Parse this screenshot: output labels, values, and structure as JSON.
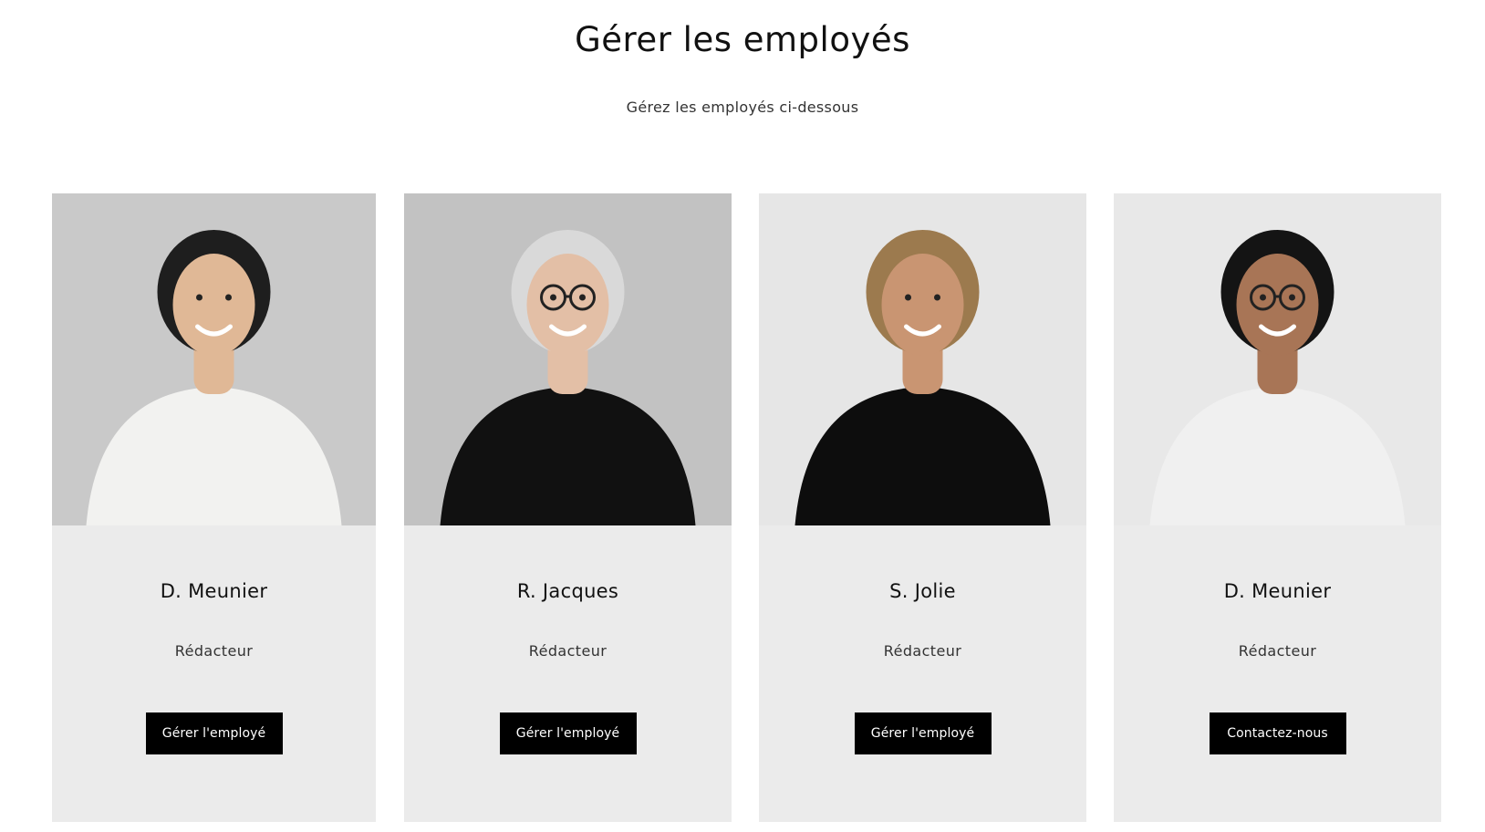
{
  "header": {
    "title": "Gérer les employés",
    "subtitle": "Gérez les employés ci-dessous"
  },
  "employees": [
    {
      "name": "D. Meunier",
      "role": "Rédacteur",
      "button_label": "Gérer l'employé",
      "photo": {
        "background": "#c9c9c9",
        "shirt": "#f2f2f0",
        "hair": "#1e1e1e",
        "skin": "#e0b896",
        "glasses": false
      }
    },
    {
      "name": "R. Jacques",
      "role": "Rédacteur",
      "button_label": "Gérer l'employé",
      "photo": {
        "background": "#c2c2c2",
        "shirt": "#111111",
        "hair": "#d9d9d9",
        "skin": "#e3bfa6",
        "glasses": true
      }
    },
    {
      "name": "S. Jolie",
      "role": "Rédacteur",
      "button_label": "Gérer l'employé",
      "photo": {
        "background": "#e6e6e6",
        "shirt": "#0d0d0d",
        "hair": "#9c7a4e",
        "skin": "#c99572",
        "glasses": false
      }
    },
    {
      "name": "D. Meunier",
      "role": "Rédacteur",
      "button_label": "Contactez-nous",
      "photo": {
        "background": "#e8e8e8",
        "shirt": "#f0f0f0",
        "hair": "#141414",
        "skin": "#a87556",
        "glasses": true
      }
    }
  ],
  "colors": {
    "card_background": "#ebebeb",
    "button_background": "#000000",
    "button_text": "#ffffff"
  }
}
